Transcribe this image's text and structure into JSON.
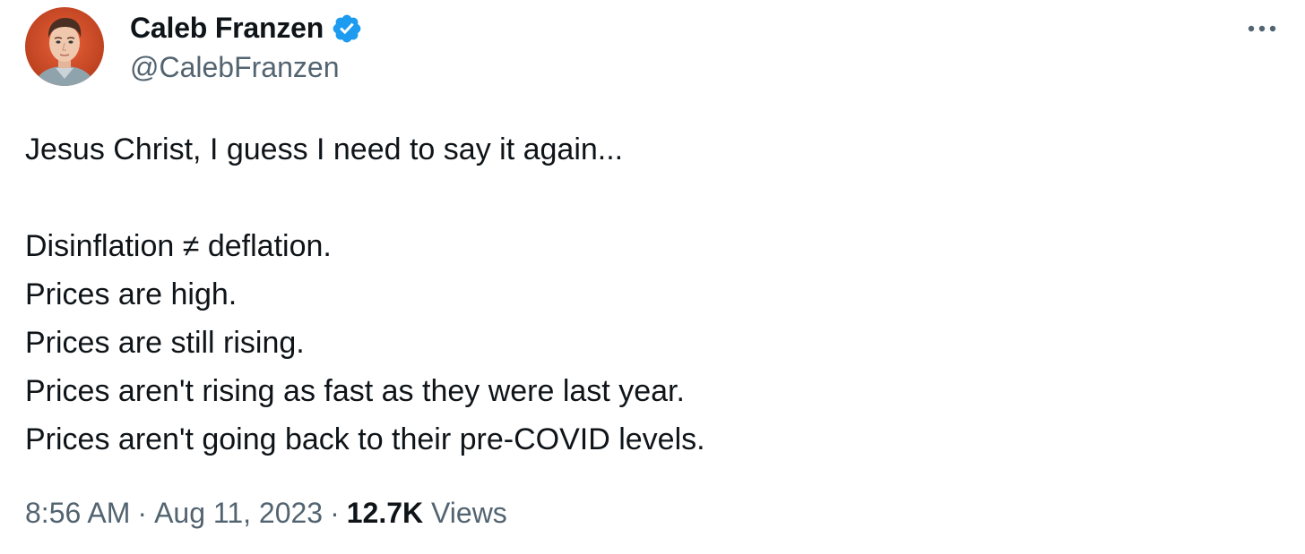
{
  "author": {
    "name": "Caleb Franzen",
    "handle": "@CalebFranzen",
    "verified": true,
    "verified_color": "#1d9bf0",
    "avatar_icon": "profile-photo"
  },
  "tweet": {
    "lines": [
      "Jesus Christ, I guess I need to say it again...",
      "",
      "Disinflation ≠ deflation.",
      "Prices are high.",
      "Prices are still rising.",
      "Prices aren't rising as fast as they were last year.",
      "Prices aren't going back to their pre-COVID levels."
    ]
  },
  "meta": {
    "time": "8:56 AM",
    "separator": "·",
    "date": "Aug 11, 2023",
    "views_count": "12.7K",
    "views_label": "Views"
  },
  "menu": {
    "more_icon": "more-horizontal-icon"
  },
  "colors": {
    "text_primary": "#0f1419",
    "text_secondary": "#536471",
    "background": "#ffffff"
  }
}
